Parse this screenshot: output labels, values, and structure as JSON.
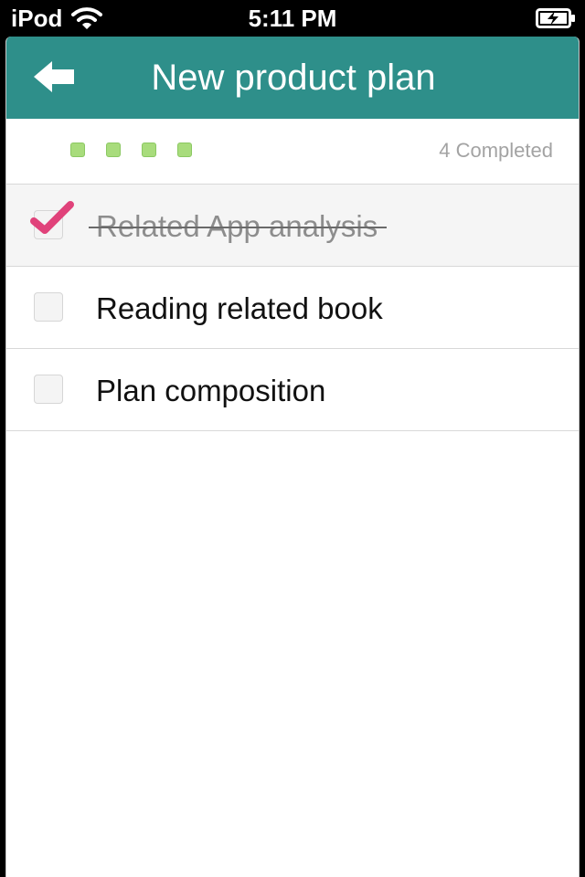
{
  "status_bar": {
    "carrier": "iPod",
    "time": "5:11 PM",
    "icons": [
      "wifi-icon",
      "battery-charging-icon"
    ]
  },
  "nav": {
    "title": "New product plan",
    "back_icon": "back-arrow-icon"
  },
  "progress": {
    "completed_text": "4 Completed",
    "dot_count": 4,
    "dot_color": "#a8dc7c"
  },
  "tasks": [
    {
      "label": "Related App analysis",
      "done": true
    },
    {
      "label": "Reading related book",
      "done": false
    },
    {
      "label": "Plan composition",
      "done": false
    }
  ],
  "colors": {
    "nav_background": "#2e8f8a",
    "check_mark": "#e0427a",
    "completed_text": "#a3a3a3"
  }
}
